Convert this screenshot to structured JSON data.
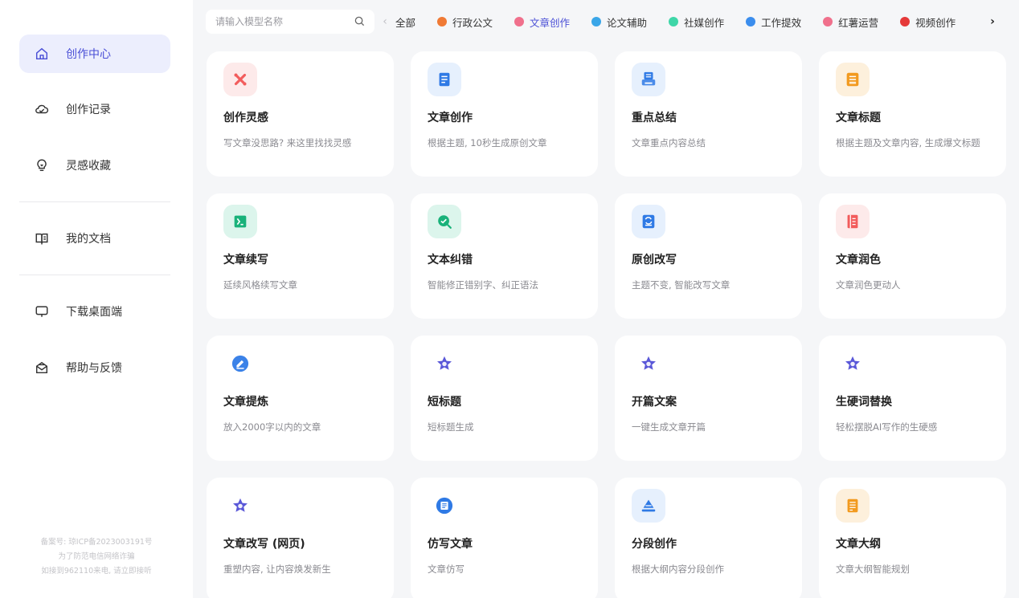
{
  "sidebar": {
    "items": [
      {
        "label": "创作中心",
        "icon": "home-icon",
        "active": true
      },
      {
        "label": "创作记录",
        "icon": "cloud-icon"
      },
      {
        "label": "灵感收藏",
        "icon": "lightbulb-icon"
      },
      {
        "label": "我的文档",
        "icon": "book-icon"
      },
      {
        "label": "下载桌面端",
        "icon": "monitor-icon"
      },
      {
        "label": "帮助与反馈",
        "icon": "mail-icon"
      }
    ],
    "footer": [
      "备案号: 琼ICP备2023003191号",
      "为了防范电信网络诈骗",
      "如接到962110来电, 请立即接听"
    ]
  },
  "search": {
    "placeholder": "请输入模型名称"
  },
  "tabs": [
    {
      "label": "全部",
      "color": ""
    },
    {
      "label": "行政公文",
      "color": "#f07a35"
    },
    {
      "label": "文章创作",
      "color": "#f0708c",
      "active": true
    },
    {
      "label": "论文辅助",
      "color": "#3aa6e8"
    },
    {
      "label": "社媒创作",
      "color": "#3ed6a8"
    },
    {
      "label": "工作提效",
      "color": "#3b8ded"
    },
    {
      "label": "红薯运营",
      "color": "#f0708c"
    },
    {
      "label": "视频创作",
      "color": "#e53939"
    }
  ],
  "cards": [
    {
      "title": "创作灵感",
      "desc": "写文章没思路? 来这里找找灵感",
      "icon": "spark-icon",
      "bg": "#fdeaea",
      "fg": "#f25c5c"
    },
    {
      "title": "文章创作",
      "desc": "根据主题, 10秒生成原创文章",
      "icon": "document-icon",
      "bg": "#e6f0fd",
      "fg": "#2f7ae5"
    },
    {
      "title": "重点总结",
      "desc": "文章重点内容总结",
      "icon": "printer-icon",
      "bg": "#e6f0fd",
      "fg": "#2f7ae5"
    },
    {
      "title": "文章标题",
      "desc": "根据主题及文章内容, 生成爆文标题",
      "icon": "title-doc-icon",
      "bg": "#fdf0dc",
      "fg": "#f29a1f"
    },
    {
      "title": "文章续写",
      "desc": "延续风格续写文章",
      "icon": "continue-doc-icon",
      "bg": "#dcf5ec",
      "fg": "#19b27a"
    },
    {
      "title": "文本纠错",
      "desc": "智能修正错别字、纠正语法",
      "icon": "check-magnifier-icon",
      "bg": "#dcf5ec",
      "fg": "#19b27a"
    },
    {
      "title": "原创改写",
      "desc": "主题不变, 智能改写文章",
      "icon": "rewrite-doc-icon",
      "bg": "#e6f0fd",
      "fg": "#2f7ae5"
    },
    {
      "title": "文章润色",
      "desc": "文章润色更动人",
      "icon": "polish-doc-icon",
      "bg": "#fdeaea",
      "fg": "#f25c5c"
    },
    {
      "title": "文章提炼",
      "desc": "放入2000字以内的文章",
      "icon": "pen-circle-icon",
      "bg": "transparent",
      "fg": "#3b82e8"
    },
    {
      "title": "短标题",
      "desc": "短标题生成",
      "icon": "star-icon",
      "bg": "transparent",
      "fg": "#5a58d8"
    },
    {
      "title": "开篇文案",
      "desc": "一键生成文章开篇",
      "icon": "star-icon",
      "bg": "transparent",
      "fg": "#5a58d8"
    },
    {
      "title": "生硬词替换",
      "desc": "轻松摆脱AI写作的生硬感",
      "icon": "star-icon",
      "bg": "transparent",
      "fg": "#5a58d8"
    },
    {
      "title": "文章改写 (网页)",
      "desc": "重塑内容, 让内容焕发新生",
      "icon": "star-icon",
      "bg": "transparent",
      "fg": "#5a58d8"
    },
    {
      "title": "仿写文章",
      "desc": "文章仿写",
      "icon": "news-circle-icon",
      "bg": "transparent",
      "fg": "#2f7ae5"
    },
    {
      "title": "分段创作",
      "desc": "根据大纲内容分段创作",
      "icon": "pyramid-icon",
      "bg": "#e6f0fd",
      "fg": "#2f7ae5"
    },
    {
      "title": "文章大纲",
      "desc": "文章大纲智能规划",
      "icon": "outline-doc-icon",
      "bg": "#fdf0dc",
      "fg": "#f29a1f"
    }
  ]
}
